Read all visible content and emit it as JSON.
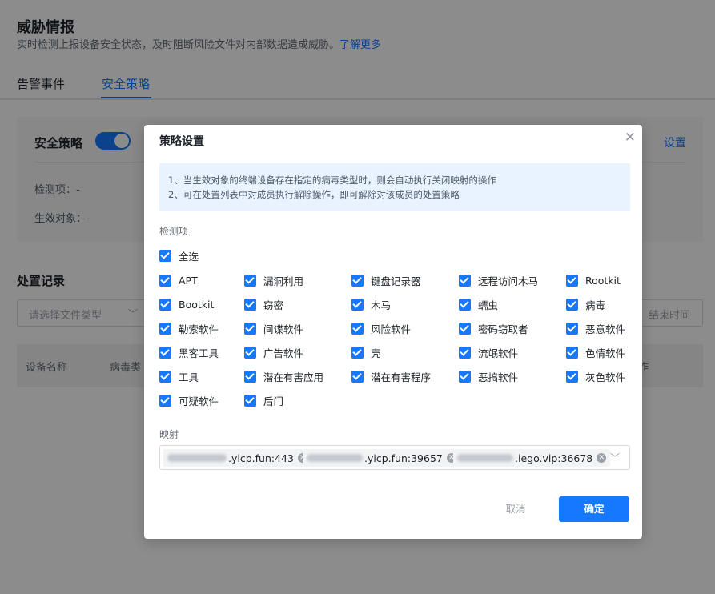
{
  "page": {
    "title": "威胁情报",
    "desc": "实时检测上报设备安全状态，及时阻断风险文件对内部数据造成威胁。",
    "learn_more": "了解更多",
    "tabs": [
      "告警事件",
      "安全策略"
    ]
  },
  "policy_card": {
    "title": "安全策略",
    "settings_link": "设置",
    "detect_label": "检测项：-",
    "target_label": "生效对象：-",
    "toggle_on": true
  },
  "records": {
    "title": "处置记录",
    "file_type_placeholder": "请选择文件类型",
    "end_time_placeholder": "结束时间",
    "columns": [
      "设备名称",
      "病毒类",
      "作"
    ]
  },
  "modal": {
    "title": "策略设置",
    "notice": [
      "1、当生效对象的终端设备存在指定的病毒类型时，则会自动执行关闭映射的操作",
      "2、可在处置列表中对成员执行解除操作，即可解除对该成员的处置策略"
    ],
    "detect_section_label": "检测项",
    "select_all": "全选",
    "detect_items": [
      [
        "APT",
        "漏洞利用",
        "键盘记录器",
        "远程访问木马",
        "Rootkit"
      ],
      [
        "Bootkit",
        "窃密",
        "木马",
        "蠕虫",
        "病毒"
      ],
      [
        "勒索软件",
        "间谍软件",
        "风险软件",
        "密码窃取者",
        "恶意软件"
      ],
      [
        "黑客工具",
        "广告软件",
        "壳",
        "流氓软件",
        "色情软件"
      ],
      [
        "工具",
        "潜在有害应用",
        "潜在有害程序",
        "恶搞软件",
        "灰色软件"
      ],
      [
        "可疑软件",
        "后门"
      ]
    ],
    "mapping_section_label": "映射",
    "mapping_tags": [
      ".yicp.fun:443",
      ".yicp.fun:39657",
      ".iego.vip:36678"
    ],
    "cancel_label": "取消",
    "ok_label": "确定",
    "accent_color": "#1677ff"
  }
}
